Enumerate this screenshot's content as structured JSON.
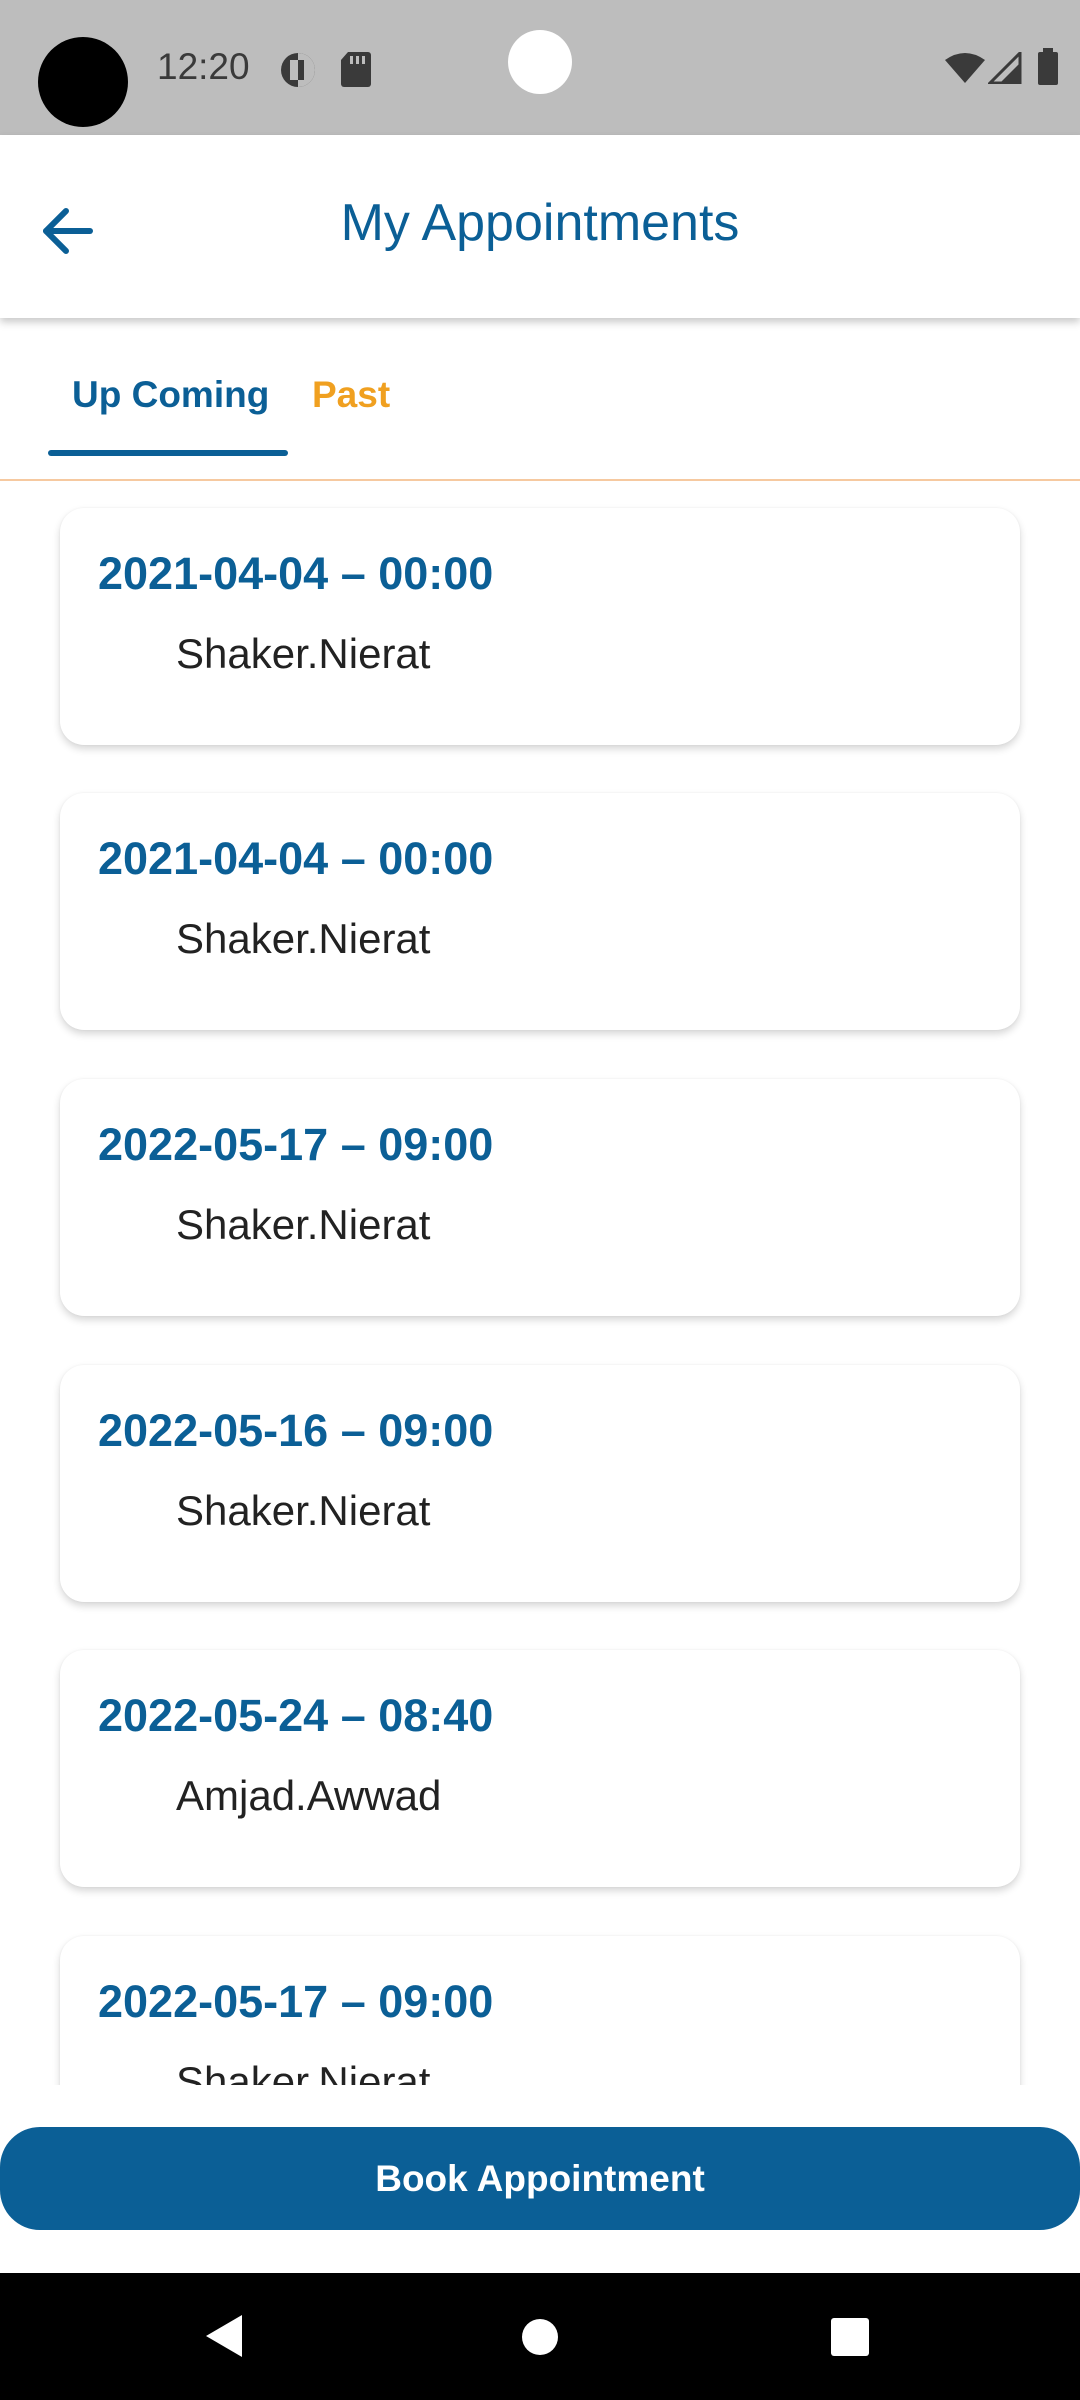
{
  "status_bar": {
    "time": "12:20",
    "icons": [
      "data-saver-icon",
      "sd-card-icon",
      "wifi-icon",
      "cellular-signal-icon",
      "battery-icon"
    ]
  },
  "app_bar": {
    "title": "My Appointments",
    "back_icon": "arrow-left-icon"
  },
  "tabs": [
    {
      "label": "Up Coming",
      "active": true
    },
    {
      "label": "Past",
      "active": false
    }
  ],
  "appointments": [
    {
      "datetime": "2021-04-04 – 00:00",
      "doctor": "Shaker.Nierat"
    },
    {
      "datetime": "2021-04-04 – 00:00",
      "doctor": "Shaker.Nierat"
    },
    {
      "datetime": "2022-05-17 – 09:00",
      "doctor": "Shaker.Nierat"
    },
    {
      "datetime": "2022-05-16 – 09:00",
      "doctor": "Shaker.Nierat"
    },
    {
      "datetime": "2022-05-24 – 08:40",
      "doctor": "Amjad.Awwad"
    },
    {
      "datetime": "2022-05-17 – 09:00",
      "doctor": "Shaker.Nierat"
    }
  ],
  "book_button": {
    "label": "Book Appointment"
  },
  "nav_bar": {
    "icons": [
      "back-triangle-icon",
      "home-circle-icon",
      "recents-square-icon"
    ]
  },
  "colors": {
    "primary": "#0b5f96",
    "accent": "#f0a020",
    "text": "#222222"
  }
}
